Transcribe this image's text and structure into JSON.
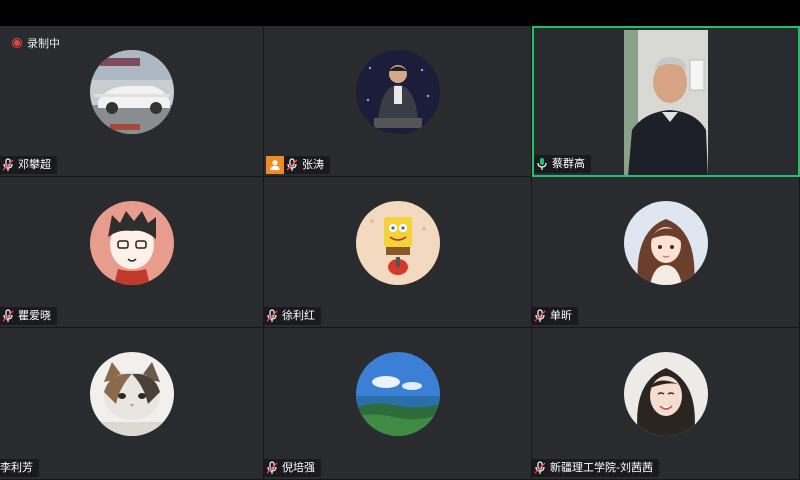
{
  "recording": {
    "label": "录制中"
  },
  "participants": [
    {
      "name": "邓攀超",
      "mic": "muted",
      "avatar": "car-photo"
    },
    {
      "name": "张涛",
      "mic": "muted",
      "avatar": "man-suit-photo",
      "host": true
    },
    {
      "name": "蔡群高",
      "mic": "active",
      "avatar": "live-video",
      "speaking": true
    },
    {
      "name": "瞿爱晓",
      "mic": "muted",
      "avatar": "cartoon-boy"
    },
    {
      "name": "徐利红",
      "mic": "muted",
      "avatar": "cartoon-sponge"
    },
    {
      "name": "单昕",
      "mic": "muted",
      "avatar": "anime-girl"
    },
    {
      "name": "李利芳",
      "mic": "none",
      "avatar": "cat-photo"
    },
    {
      "name": "倪培强",
      "mic": "muted",
      "avatar": "landscape-photo"
    },
    {
      "name": "新疆理工学院-刘茜茜",
      "mic": "muted",
      "avatar": "girl-photo"
    }
  ],
  "colors": {
    "tile_bg": "#2a2b2f",
    "active_border": "#21c16b",
    "host_badge": "#f08a24",
    "rec_red": "#e84545"
  }
}
